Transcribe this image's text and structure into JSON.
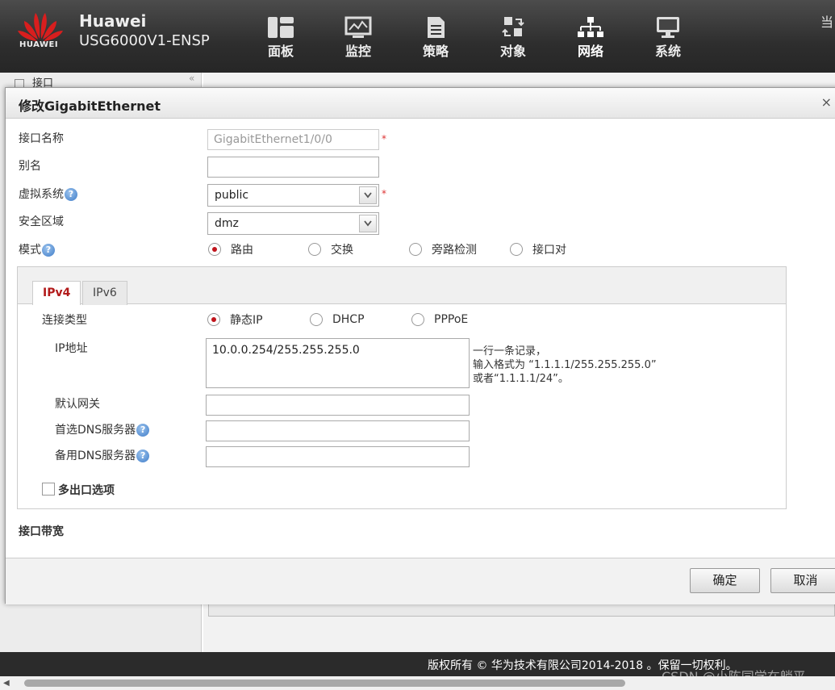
{
  "header": {
    "brand": "Huawei",
    "model": "USG6000V1-ENSP",
    "logo_text": "HUAWEI",
    "corner_char": "当",
    "nav": [
      {
        "label": "面板",
        "icon": "dashboard-icon"
      },
      {
        "label": "监控",
        "icon": "monitor-icon"
      },
      {
        "label": "策略",
        "icon": "policy-icon"
      },
      {
        "label": "对象",
        "icon": "object-icon"
      },
      {
        "label": "网络",
        "icon": "network-icon",
        "active": true
      },
      {
        "label": "系统",
        "icon": "system-icon"
      }
    ]
  },
  "background": {
    "side_item": "接口"
  },
  "dialog": {
    "title": "修改GigabitEthernet",
    "close": "×",
    "fields": {
      "name_label": "接口名称",
      "name_value": "GigabitEthernet1/0/0",
      "alias_label": "别名",
      "alias_value": "",
      "vsys_label": "虚拟系统",
      "vsys_value": "public",
      "zone_label": "安全区域",
      "zone_value": "dmz",
      "mode_label": "模式",
      "required_mark": "*",
      "help_mark": "?"
    },
    "mode_options": [
      "路由",
      "交换",
      "旁路检测",
      "接口对"
    ],
    "mode_selected": "路由",
    "tabs": [
      "IPv4",
      "IPv6"
    ],
    "active_tab": "IPv4",
    "ipv4": {
      "conn_type_label": "连接类型",
      "conn_options": [
        "静态IP",
        "DHCP",
        "PPPoE"
      ],
      "conn_selected": "静态IP",
      "ip_label": "IP地址",
      "ip_value": "10.0.0.254/255.255.255.0",
      "hint_line1": "一行一条记录，",
      "hint_line2": "输入格式为 “1.1.1.1/255.255.255.0”",
      "hint_line3": "或者“1.1.1.1/24”。",
      "gateway_label": "默认网关",
      "dns1_label": "首选DNS服务器",
      "dns2_label": "备用DNS服务器",
      "multi_exit_label": "多出口选项"
    },
    "bandwidth_label": "接口带宽",
    "ok_label": "确定",
    "cancel_label": "取消"
  },
  "footer": {
    "copyright": "版权所有 © 华为技术有限公司2014-2018 。保留一切权利。",
    "watermark": "CSDN @小陈同学在躺平"
  },
  "colors": {
    "accent_red": "#c0141c",
    "header_bg": "#2e2e2e"
  }
}
